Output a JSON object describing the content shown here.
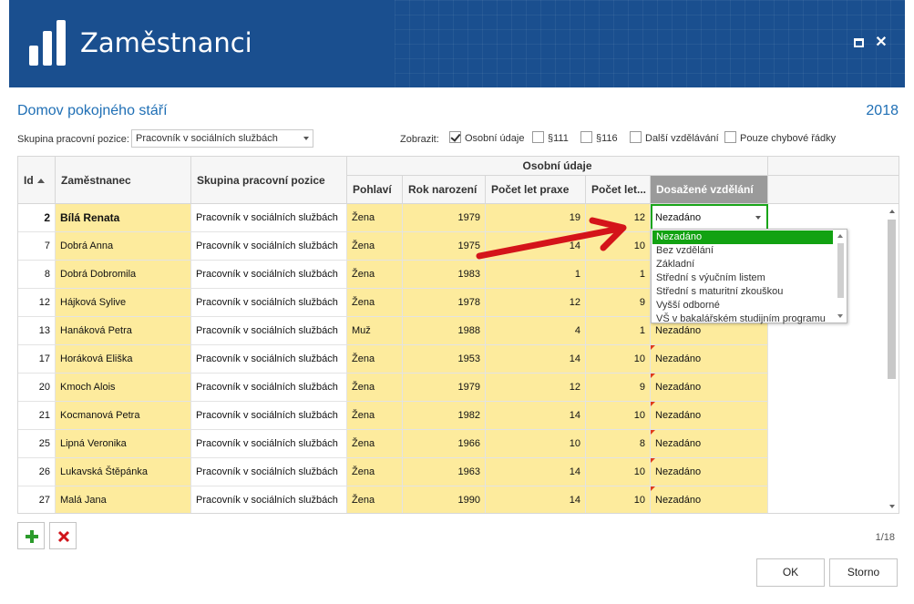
{
  "window": {
    "title": "Zaměstnanci"
  },
  "org_name": "Domov pokojného stáří",
  "year": "2018",
  "filter": {
    "group_label": "Skupina pracovní pozice:",
    "group_value": "Pracovník v sociálních službách",
    "show_label": "Zobrazit:",
    "checkboxes": [
      {
        "label": "Osobní údaje",
        "checked": true
      },
      {
        "label": "§111",
        "checked": false
      },
      {
        "label": "§116",
        "checked": false
      },
      {
        "label": "Další vzdělávání",
        "checked": false
      },
      {
        "label": "Pouze chybové řádky",
        "checked": false
      }
    ]
  },
  "grid": {
    "headers": {
      "id": "Id",
      "employee": "Zaměstnanec",
      "group": "Skupina pracovní pozice",
      "band": "Osobní údaje",
      "gender": "Pohlaví",
      "birth_year": "Rok narození",
      "practice": "Počet let praxe",
      "years": "Počet let...",
      "education": "Dosažené vzdělání"
    },
    "rows": [
      {
        "id": "2",
        "name": "Bílá Renata",
        "group": "Pracovník v sociálních službách",
        "gender": "Žena",
        "birth": "1979",
        "practice": "19",
        "years": "12",
        "education": "Nezadáno"
      },
      {
        "id": "7",
        "name": "Dobrá Anna",
        "group": "Pracovník v sociálních službách",
        "gender": "Žena",
        "birth": "1975",
        "practice": "14",
        "years": "10",
        "education": ""
      },
      {
        "id": "8",
        "name": "Dobrá Dobromila",
        "group": "Pracovník v sociálních službách",
        "gender": "Žena",
        "birth": "1983",
        "practice": "1",
        "years": "1",
        "education": ""
      },
      {
        "id": "12",
        "name": "Hájková Sylive",
        "group": "Pracovník v sociálních službách",
        "gender": "Žena",
        "birth": "1978",
        "practice": "12",
        "years": "9",
        "education": ""
      },
      {
        "id": "13",
        "name": "Hanáková Petra",
        "group": "Pracovník v sociálních službách",
        "gender": "Muž",
        "birth": "1988",
        "practice": "4",
        "years": "1",
        "education": "Nezadáno"
      },
      {
        "id": "17",
        "name": "Horáková Eliška",
        "group": "Pracovník v sociálních službách",
        "gender": "Žena",
        "birth": "1953",
        "practice": "14",
        "years": "10",
        "education": "Nezadáno"
      },
      {
        "id": "20",
        "name": "Kmoch Alois",
        "group": "Pracovník v sociálních službách",
        "gender": "Žena",
        "birth": "1979",
        "practice": "12",
        "years": "9",
        "education": "Nezadáno"
      },
      {
        "id": "21",
        "name": "Kocmanová Petra",
        "group": "Pracovník v sociálních službách",
        "gender": "Žena",
        "birth": "1982",
        "practice": "14",
        "years": "10",
        "education": "Nezadáno"
      },
      {
        "id": "25",
        "name": "Lipná Veronika",
        "group": "Pracovník v sociálních službách",
        "gender": "Žena",
        "birth": "1966",
        "practice": "10",
        "years": "8",
        "education": "Nezadáno"
      },
      {
        "id": "26",
        "name": "Lukavská Štěpánka",
        "group": "Pracovník v sociálních službách",
        "gender": "Žena",
        "birth": "1963",
        "practice": "14",
        "years": "10",
        "education": "Nezadáno"
      },
      {
        "id": "27",
        "name": "Malá Jana",
        "group": "Pracovník v sociálních službách",
        "gender": "Žena",
        "birth": "1990",
        "practice": "14",
        "years": "10",
        "education": "Nezadáno"
      }
    ]
  },
  "dropdown_options": [
    "Nezadáno",
    "Bez vzdělání",
    "Základní",
    "Střední s výučním listem",
    "Střední s maturitní zkouškou",
    "Vyšší odborné",
    "VŠ v bakalářském studijním programu"
  ],
  "pager": "1/18",
  "buttons": {
    "ok": "OK",
    "cancel": "Storno"
  },
  "colors": {
    "header": "#1a4f8f",
    "accent_text": "#1f6fb5",
    "editable_cell": "#fdeb9d",
    "selection": "#12a212",
    "arrow": "#d4141a"
  },
  "icons": {
    "add": "plus-icon",
    "delete": "x-icon"
  }
}
